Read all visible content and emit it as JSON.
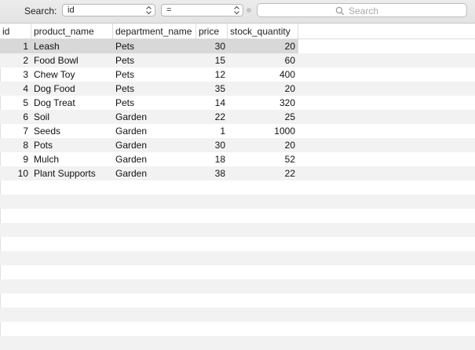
{
  "filter": {
    "label": "Search:",
    "column_value": "id",
    "operator_value": "=",
    "search_placeholder": "Search"
  },
  "columns": [
    "id",
    "product_name",
    "department_name",
    "price",
    "stock_quantity"
  ],
  "rows": [
    {
      "id": "1",
      "product_name": "Leash",
      "department_name": "Pets",
      "price": "30",
      "stock_quantity": "20"
    },
    {
      "id": "2",
      "product_name": "Food Bowl",
      "department_name": "Pets",
      "price": "15",
      "stock_quantity": "60"
    },
    {
      "id": "3",
      "product_name": "Chew Toy",
      "department_name": "Pets",
      "price": "12",
      "stock_quantity": "400"
    },
    {
      "id": "4",
      "product_name": "Dog Food",
      "department_name": "Pets",
      "price": "35",
      "stock_quantity": "20"
    },
    {
      "id": "5",
      "product_name": "Dog Treat",
      "department_name": "Pets",
      "price": "14",
      "stock_quantity": "320"
    },
    {
      "id": "6",
      "product_name": "Soil",
      "department_name": "Garden",
      "price": "22",
      "stock_quantity": "25"
    },
    {
      "id": "7",
      "product_name": "Seeds",
      "department_name": "Garden",
      "price": "1",
      "stock_quantity": "1000"
    },
    {
      "id": "8",
      "product_name": "Pots",
      "department_name": "Garden",
      "price": "30",
      "stock_quantity": "20"
    },
    {
      "id": "9",
      "product_name": "Mulch",
      "department_name": "Garden",
      "price": "18",
      "stock_quantity": "52"
    },
    {
      "id": "10",
      "product_name": "Plant Supports",
      "department_name": "Garden",
      "price": "38",
      "stock_quantity": "22"
    }
  ],
  "selected_row_index": 0,
  "colors": {
    "selected_row": "#d8d8d8",
    "alternate_row": "#f2f2f2",
    "toolbar": "#e6e6e6"
  }
}
